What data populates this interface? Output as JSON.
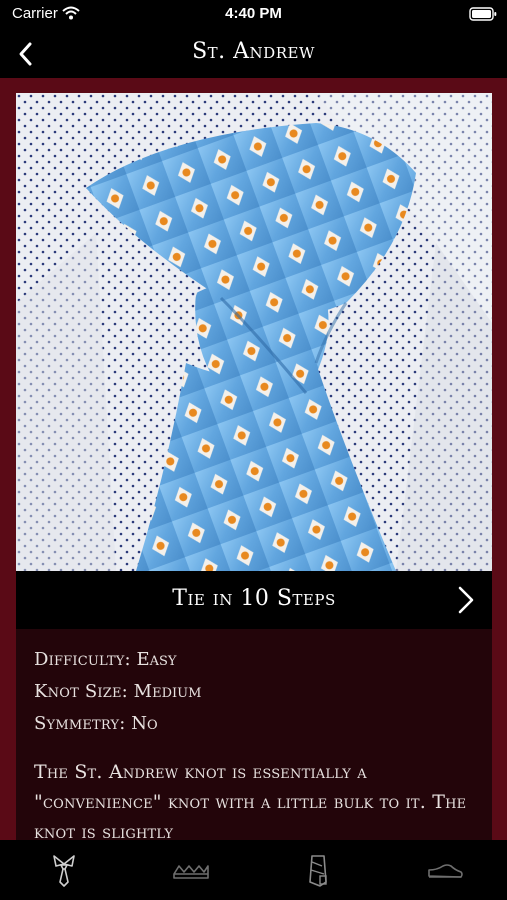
{
  "status": {
    "carrier": "Carrier",
    "time": "4:40 PM"
  },
  "nav": {
    "title": "St. Andrew"
  },
  "steps_button": {
    "label": "Tie in 10 Steps"
  },
  "info": {
    "difficulty_key": "Difficulty:",
    "difficulty_value": "Easy",
    "knot_size_key": "Knot Size:",
    "knot_size_value": "Medium",
    "symmetry_key": "Symmetry:",
    "symmetry_value": "No",
    "description": "The St. Andrew knot is essentially a \"convenience\" knot with a little bulk to it. The knot is slightly"
  },
  "tabs": [
    {
      "icon": "tie-collar-icon"
    },
    {
      "icon": "folded-shirts-icon"
    },
    {
      "icon": "shirt-sleeve-icon"
    },
    {
      "icon": "shoe-icon"
    }
  ],
  "colors": {
    "accent": "#5a0a16",
    "panel": "#23050a",
    "tie": "#6fb1e4"
  }
}
